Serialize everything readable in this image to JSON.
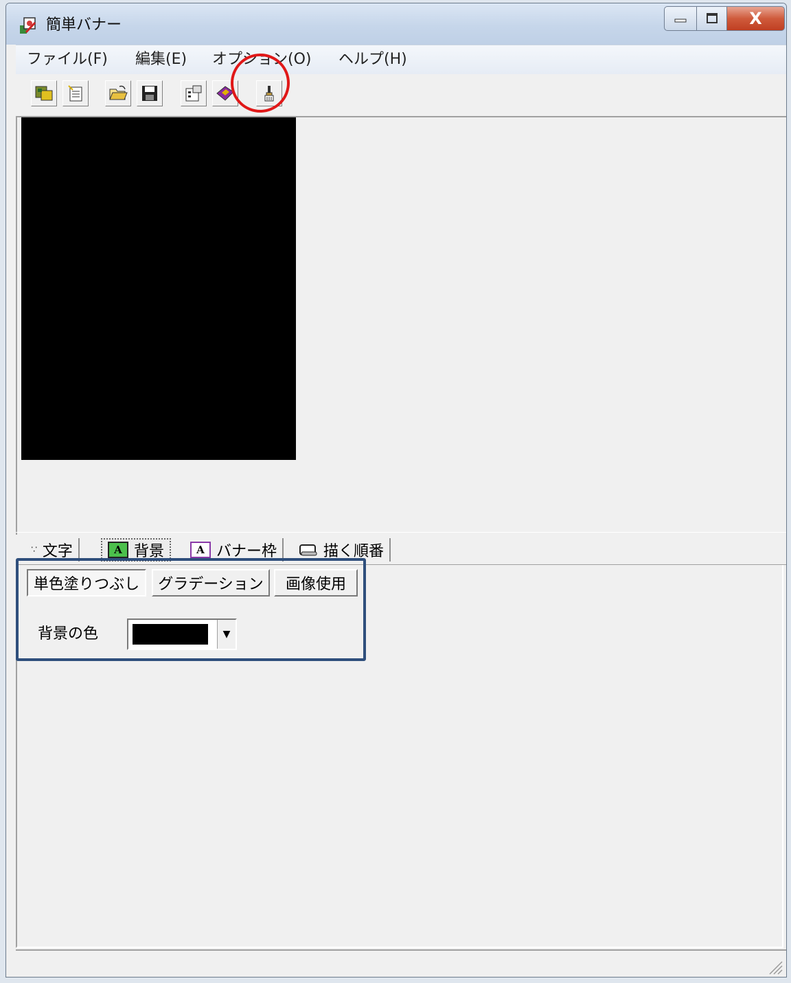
{
  "window": {
    "title": "簡単バナー",
    "caption_buttons": {
      "minimize_icon": "minimize-icon",
      "maximize_icon": "maximize-icon",
      "close_label": "X"
    }
  },
  "menubar": {
    "items": [
      "ファイル(F)",
      "編集(E)",
      "オプション(O)",
      "ヘルプ(H)"
    ]
  },
  "toolbar": {
    "tools": [
      "new-banner-icon",
      "paste-icon",
      "open-folder-icon",
      "save-disk-icon",
      "properties-icon",
      "book-icon",
      "paintbrush-icon"
    ]
  },
  "preview": {
    "background_color": "#000000"
  },
  "tabs": [
    {
      "label": "文字",
      "icon": "text-tab-icon"
    },
    {
      "label": "背景",
      "icon": "background-tab-icon",
      "active": true
    },
    {
      "label": "バナー枠",
      "icon": "banner-frame-tab-icon"
    },
    {
      "label": "描く順番",
      "icon": "draw-order-tab-icon"
    }
  ],
  "background_panel": {
    "subtabs": [
      "単色塗りつぶし",
      "グラデーション",
      "画像使用"
    ],
    "color_label": "背景の色",
    "color_value": "#000000"
  },
  "annotations": {
    "circle_color": "#e01818",
    "rect_color": "#2f4f7c"
  }
}
